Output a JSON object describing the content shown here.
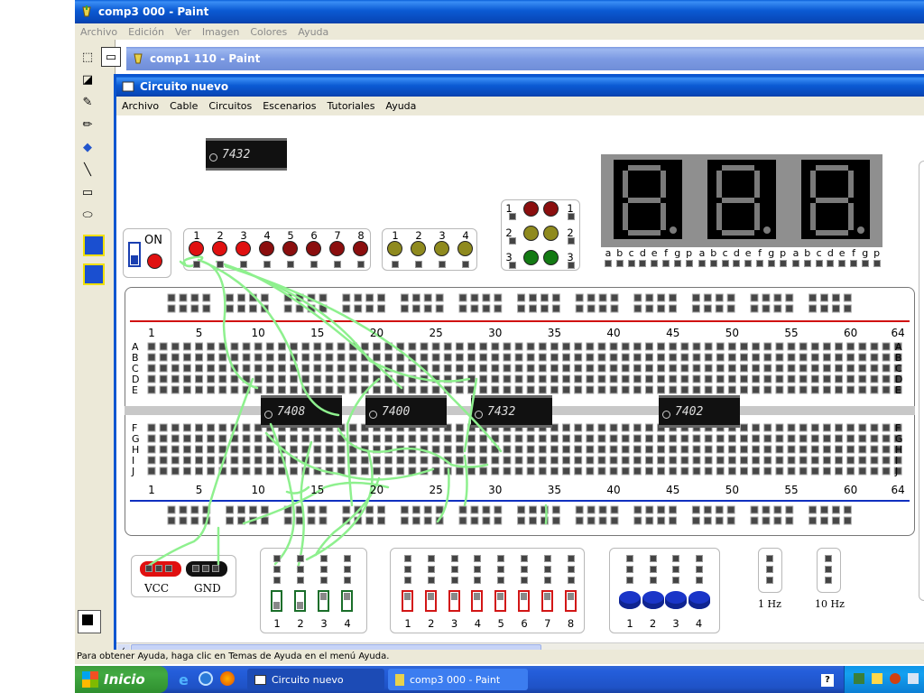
{
  "back_window": {
    "title": "comp3 000 - Paint",
    "menu": [
      "Archivo",
      "Edición",
      "Ver",
      "Imagen",
      "Colores",
      "Ayuda"
    ]
  },
  "mid_window": {
    "title": "comp1 110 - Paint"
  },
  "app": {
    "title": "Circuito nuevo",
    "menu": [
      "Archivo",
      "Cable",
      "Circuitos",
      "Escenarios",
      "Tutoriales",
      "Ayuda"
    ],
    "on_label": "ON",
    "loose_chip": "7432",
    "led_red_numbers": [
      "1",
      "2",
      "3",
      "4",
      "5",
      "6",
      "7",
      "8"
    ],
    "led_yellow_numbers": [
      "1",
      "2",
      "3",
      "4"
    ],
    "traffic_numbers": [
      "1",
      "2",
      "3"
    ],
    "display_pins": [
      "a",
      "b",
      "c",
      "d",
      "e",
      "f",
      "g",
      "p"
    ],
    "breadboard": {
      "col_numbers": [
        "1",
        "5",
        "10",
        "15",
        "20",
        "25",
        "30",
        "35",
        "40",
        "45",
        "50",
        "55",
        "60",
        "64"
      ],
      "rows_top": [
        "A",
        "B",
        "C",
        "D",
        "E"
      ],
      "rows_bottom": [
        "F",
        "G",
        "H",
        "I",
        "J"
      ],
      "chips": [
        "7408",
        "7400",
        "7432",
        "7402"
      ]
    },
    "power": {
      "vcc": "VCC",
      "gnd": "GND"
    },
    "switch_green_numbers": [
      "1",
      "2",
      "3",
      "4"
    ],
    "switch_red_numbers": [
      "1",
      "2",
      "3",
      "4",
      "5",
      "6",
      "7",
      "8"
    ],
    "button_numbers": [
      "1",
      "2",
      "3",
      "4"
    ],
    "clock_1": "1 Hz",
    "clock_10": "10 Hz"
  },
  "status_bar": {
    "text": "Para obtener Ayuda, haga clic en Temas de Ayuda en el menú Ayuda."
  },
  "taskbar": {
    "start": "Inicio",
    "items": [
      "Circuito nuevo",
      "comp3 000 - Paint"
    ],
    "help": "?"
  },
  "colors": {
    "led_red": "#e01010",
    "led_dark_red": "#8b0e0e",
    "led_olive": "#8f8a1e",
    "traffic_green": "#137a13",
    "wire": "#8ef08e",
    "rail_red": "#d01010",
    "rail_blue": "#1030c0",
    "button_blue": "#1a35c8"
  }
}
